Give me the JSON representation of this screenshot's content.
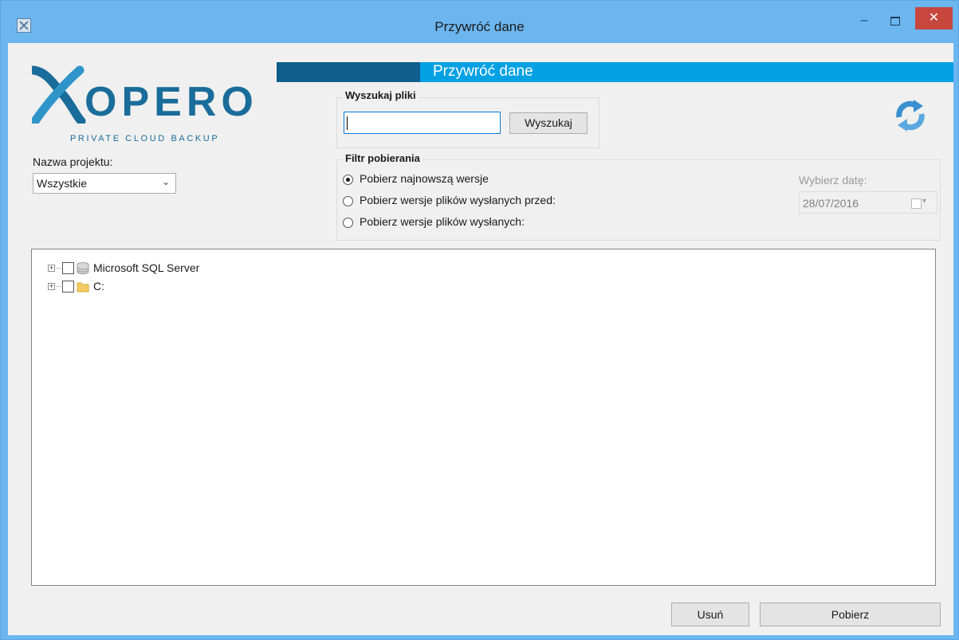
{
  "window": {
    "title": "Przywróć dane",
    "minimize_glyph": "–",
    "close_glyph": "✕"
  },
  "logo": {
    "word": "OPERO",
    "tagline": "PRIVATE CLOUD BACKUP"
  },
  "header": {
    "title": "Przywróć dane"
  },
  "project": {
    "label": "Nazwa projektu:",
    "selected": "Wszystkie",
    "chevron": "⌄"
  },
  "search": {
    "group_title": "Wyszukaj pliki",
    "input_value": "",
    "button_label": "Wyszukaj"
  },
  "filter": {
    "group_title": "Filtr pobierania",
    "options": [
      {
        "label": "Pobierz najnowszą wersje",
        "checked": true
      },
      {
        "label": "Pobierz wersje plików wysłanych przed:",
        "checked": false
      },
      {
        "label": "Pobierz wersje plików wysłanych:",
        "checked": false
      }
    ],
    "date_label": "Wybierz datę:",
    "date_value": "28/07/2016"
  },
  "tree": {
    "items": [
      {
        "label": "Microsoft SQL Server",
        "icon": "database-icon",
        "expander": "+"
      },
      {
        "label": "C:",
        "icon": "folder-icon",
        "expander": "+"
      }
    ]
  },
  "footer": {
    "delete_label": "Usuń",
    "download_label": "Pobierz"
  },
  "colors": {
    "titlebar": "#6cb6f0",
    "header_accent": "#01a1e4",
    "header_dark": "#0e5d8a",
    "close_button": "#c7463e",
    "brand": "#1a6d9a"
  }
}
